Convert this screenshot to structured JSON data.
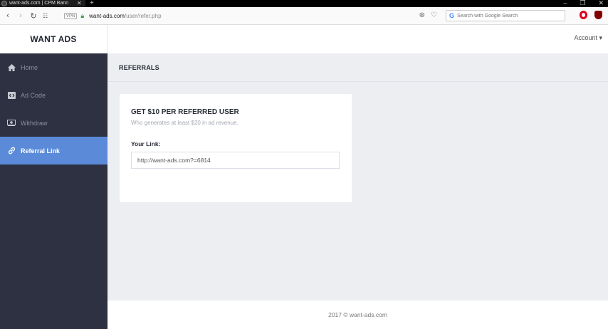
{
  "browser": {
    "tab_title": "want-ads.com | CPM Bann",
    "tab_close": "✕",
    "new_tab": "+",
    "win_min": "‒",
    "win_restore": "❐",
    "win_close": "✕",
    "vpn_badge": "VPN",
    "url_host": "want-ads.com",
    "url_path": "/user/refer.php",
    "search_placeholder": "Search with Google Search",
    "search_icon": "G"
  },
  "app": {
    "brand": "WANT ADS",
    "account_label": "Account ▾",
    "sidebar": {
      "items": [
        {
          "label": "Home",
          "icon": "home-icon"
        },
        {
          "label": "Ad Code",
          "icon": "code-icon"
        },
        {
          "label": "Withdraw",
          "icon": "cash-icon"
        },
        {
          "label": "Referral Link",
          "icon": "link-icon",
          "active": true
        }
      ]
    },
    "page_title": "REFERRALS",
    "card": {
      "title": "GET $10 PER REFERRED USER",
      "subtitle": "Who generates at least $20 in ad revenue.",
      "link_label": "Your Link:",
      "link_value": "http://want-ads.com?=6814"
    },
    "footer": "2017 © want-ads.com"
  },
  "colors": {
    "sidebar_bg": "#2d3141",
    "active_item": "#5b8bd8",
    "content_bg": "#eceef2"
  }
}
